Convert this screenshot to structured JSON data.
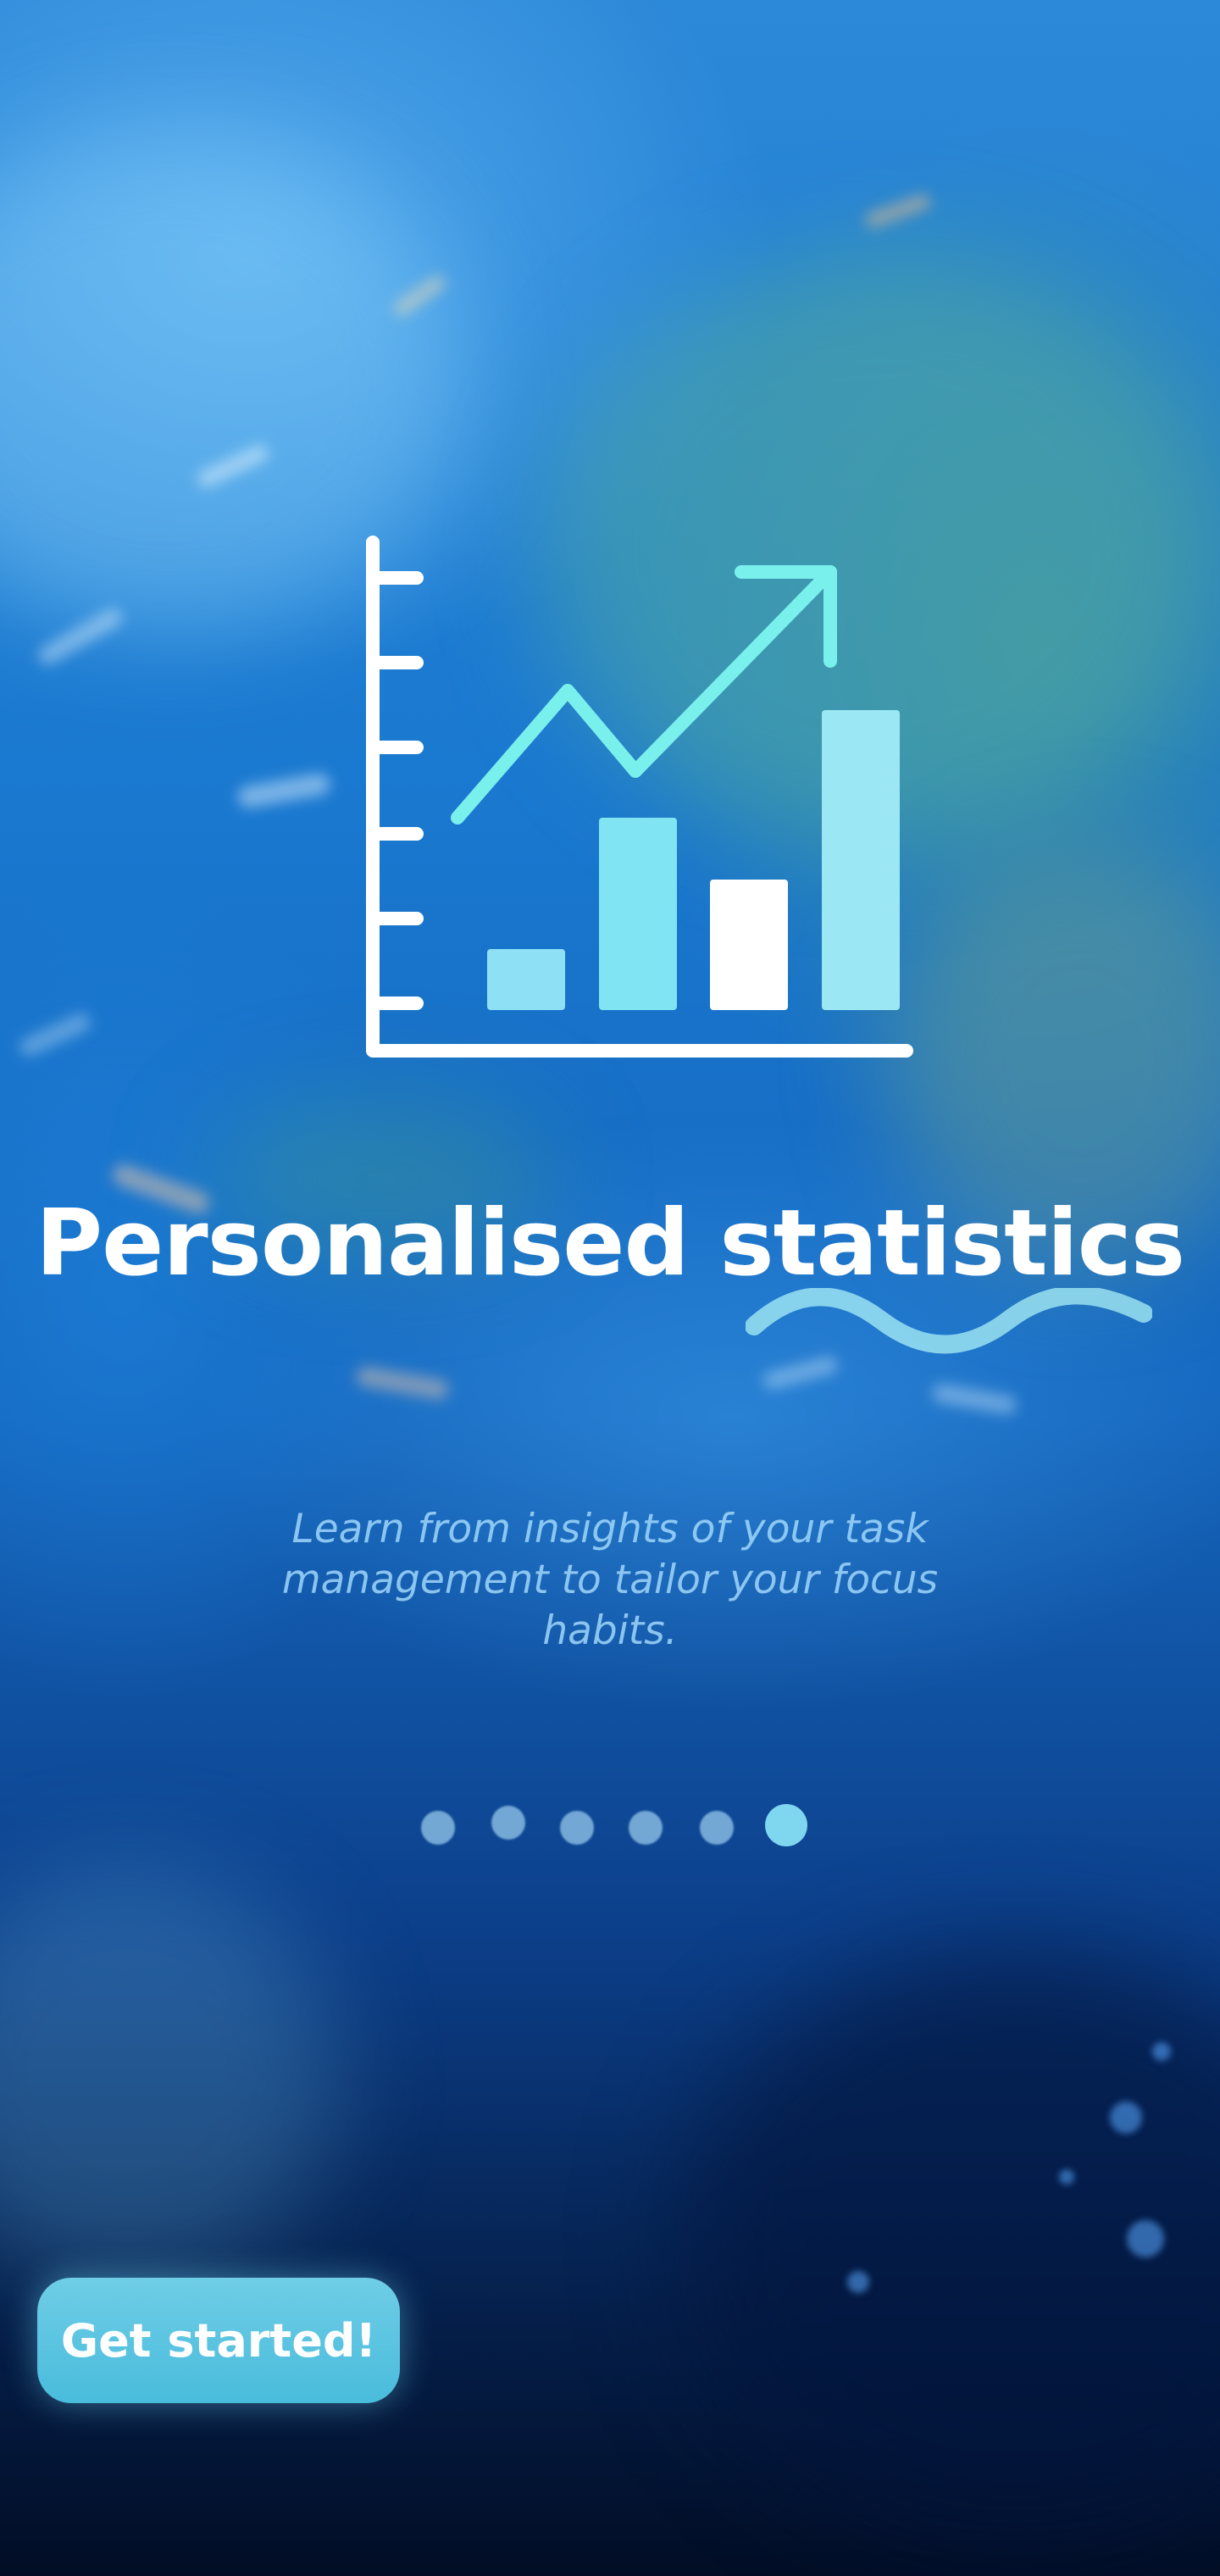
{
  "colors": {
    "accent": "#7fd6ef",
    "button_bg": "#58c3e1",
    "text_primary": "#ffffff",
    "text_secondary": "#a0d7fa",
    "background_deep": "#020d25"
  },
  "hero": {
    "icon": "statistics-chart-icon"
  },
  "headline": {
    "part_1": "Personalised ",
    "part_2": "statistics"
  },
  "description": {
    "text": "Learn from insights of your task management to tailor your focus habits."
  },
  "pager": {
    "total": 6,
    "active_index": 5
  },
  "cta": {
    "label": "Get started!"
  }
}
